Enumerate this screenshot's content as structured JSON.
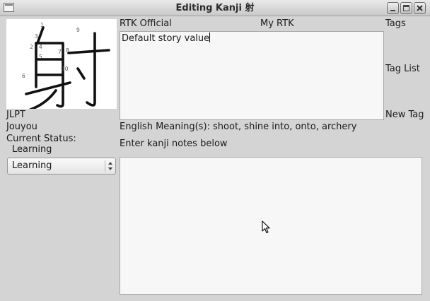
{
  "window": {
    "title": "Editing Kanji 射",
    "controls": [
      "minimize-icon",
      "maximize-icon",
      "close-icon"
    ]
  },
  "kanji": {
    "character": "射",
    "stroke_numbers": [
      "1",
      "2",
      "3",
      "4",
      "5",
      "6",
      "7",
      "8",
      "9",
      "10"
    ]
  },
  "info": {
    "jlpt_label": "JLPT",
    "jouyou_label": "Jouyou",
    "current_status_label": "Current Status:",
    "current_status_value": "Learning"
  },
  "status_select": {
    "selected": "Learning"
  },
  "story": {
    "rtk_official_label": "RTK Official",
    "my_rtk_label": "My RTK",
    "text": "Default story value"
  },
  "tags": {
    "tags_label": "Tags",
    "tag_list_label": "Tag List",
    "new_tag_label": "New Tag"
  },
  "meaning": {
    "text": "English Meaning(s): shoot, shine into, onto, archery"
  },
  "notes": {
    "prompt": "Enter kanji notes below",
    "text": ""
  },
  "colors": {
    "window_bg": "#d4d4d4",
    "field_bg": "#f7f7f7",
    "field_border": "#a6a6a6"
  }
}
